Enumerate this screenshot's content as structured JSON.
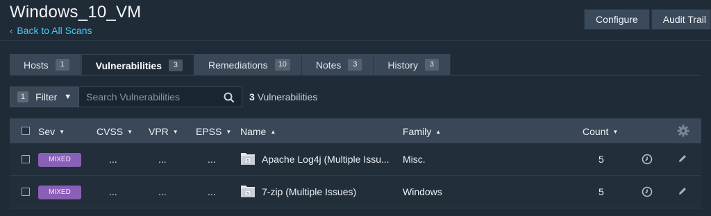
{
  "header": {
    "title": "Windows_10_VM",
    "back_link": "Back to All Scans",
    "buttons": [
      "Configure",
      "Audit Trail"
    ]
  },
  "tabs": [
    {
      "label": "Hosts",
      "count": "1",
      "active": false
    },
    {
      "label": "Vulnerabilities",
      "count": "3",
      "active": true
    },
    {
      "label": "Remediations",
      "count": "10",
      "active": false
    },
    {
      "label": "Notes",
      "count": "3",
      "active": false
    },
    {
      "label": "History",
      "count": "3",
      "active": false
    }
  ],
  "filter": {
    "count": "1",
    "label": "Filter",
    "search_placeholder": "Search Vulnerabilities",
    "result_count": "3",
    "result_label": "Vulnerabilities"
  },
  "table": {
    "columns": {
      "sev": "Sev",
      "cvss": "CVSS",
      "vpr": "VPR",
      "epss": "EPSS",
      "name": "Name",
      "family": "Family",
      "count": "Count"
    },
    "rows": [
      {
        "sev": "MIXED",
        "cvss": "...",
        "vpr": "...",
        "epss": "...",
        "plugin_count": "5",
        "name": "Apache Log4j (Multiple Issu...",
        "family": "Misc.",
        "count": "5"
      },
      {
        "sev": "MIXED",
        "cvss": "...",
        "vpr": "...",
        "epss": "...",
        "plugin_count": "5",
        "name": "7-zip (Multiple Issues)",
        "family": "Windows",
        "count": "5"
      }
    ]
  },
  "colors": {
    "background": "#202b38",
    "panel": "#3a4756",
    "link": "#4cc7f0",
    "mixed_badge": "#8a5fb8"
  }
}
